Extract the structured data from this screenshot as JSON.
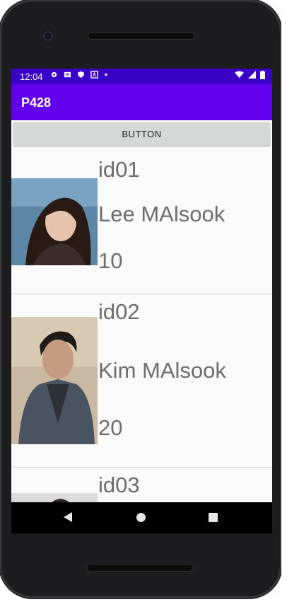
{
  "status_bar": {
    "time": "12:04",
    "left_icons": [
      "gear-icon",
      "message-icon",
      "shield-icon",
      "a-icon",
      "dot-icon"
    ],
    "right_icons": [
      "wifi-icon",
      "signal-icon",
      "battery-icon"
    ]
  },
  "app_bar": {
    "title": "P428"
  },
  "button": {
    "label": "BUTTON"
  },
  "items": [
    {
      "id": "id01",
      "name": "Lee MAlsook",
      "value": "10"
    },
    {
      "id": "id02",
      "name": "Kim MAlsook",
      "value": "20"
    },
    {
      "id": "id03"
    }
  ],
  "nav": {
    "icons": [
      "back-icon",
      "home-icon",
      "recents-icon"
    ]
  },
  "colors": {
    "primary": "#6200ee",
    "status_bar": "#3a00c8",
    "text": "#6d6d6d"
  }
}
